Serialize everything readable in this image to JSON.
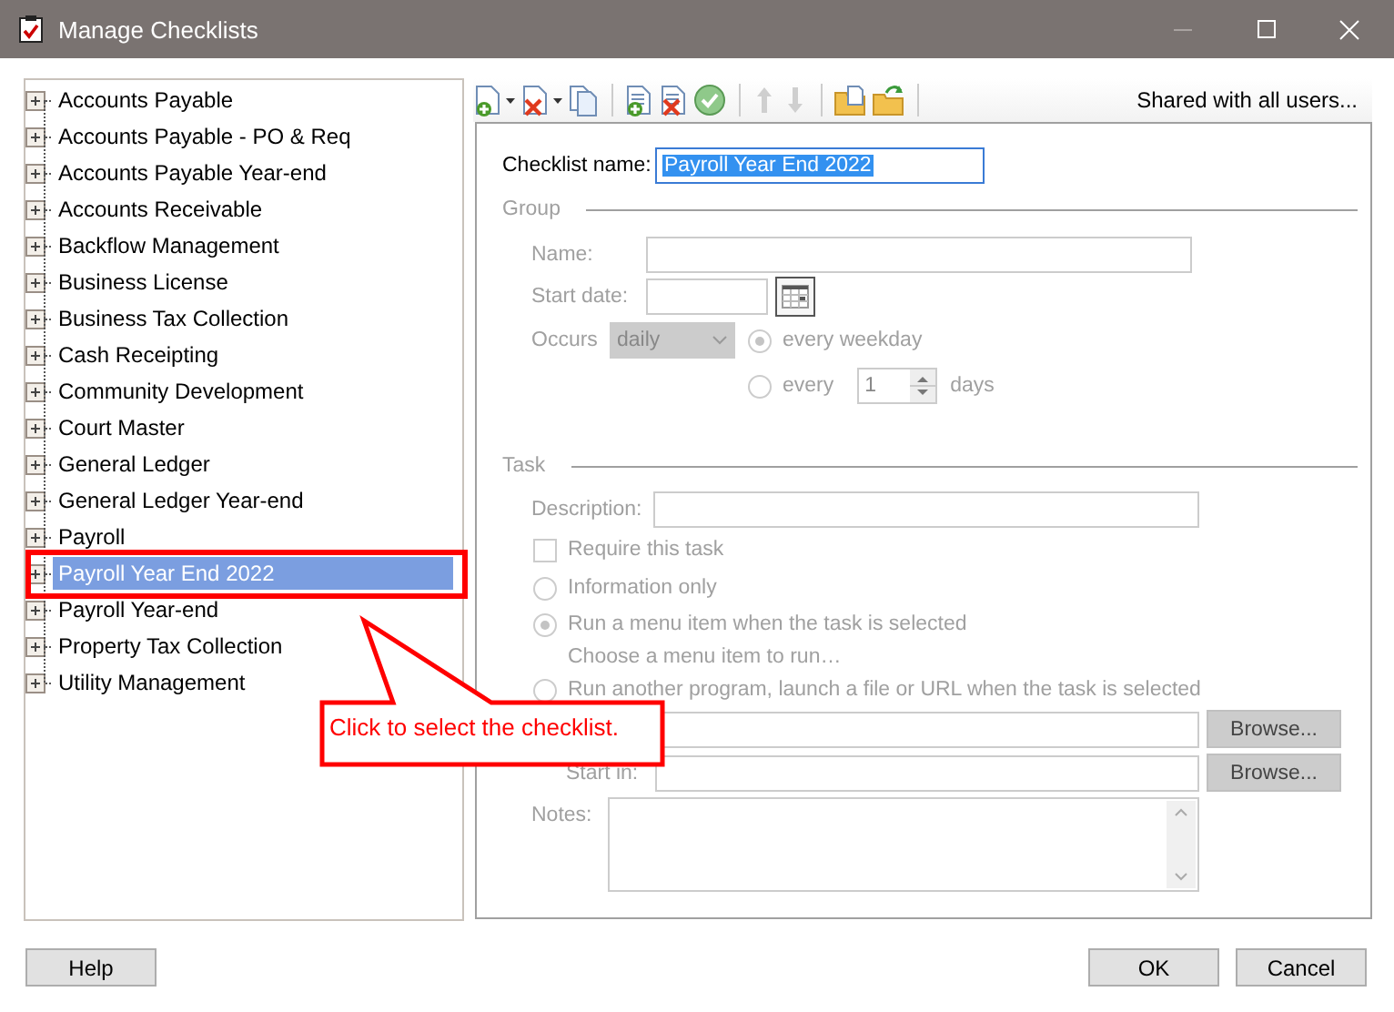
{
  "window": {
    "title": "Manage Checklists"
  },
  "checklists": [
    {
      "label": "Accounts Payable",
      "selected": false
    },
    {
      "label": "Accounts Payable - PO & Req",
      "selected": false
    },
    {
      "label": "Accounts Payable Year-end",
      "selected": false
    },
    {
      "label": "Accounts Receivable",
      "selected": false
    },
    {
      "label": "Backflow Management",
      "selected": false
    },
    {
      "label": "Business License",
      "selected": false
    },
    {
      "label": "Business Tax Collection",
      "selected": false
    },
    {
      "label": "Cash Receipting",
      "selected": false
    },
    {
      "label": "Community Development",
      "selected": false
    },
    {
      "label": "Court Master",
      "selected": false
    },
    {
      "label": "General Ledger",
      "selected": false
    },
    {
      "label": "General Ledger Year-end",
      "selected": false
    },
    {
      "label": "Payroll",
      "selected": false
    },
    {
      "label": "Payroll Year End 2022",
      "selected": true
    },
    {
      "label": "Payroll Year-end",
      "selected": false
    },
    {
      "label": "Property Tax Collection",
      "selected": false
    },
    {
      "label": "Utility Management",
      "selected": false
    }
  ],
  "toolbar": {
    "shared_link": "Shared with all users..."
  },
  "form": {
    "checklist_name_label": "Checklist name:",
    "checklist_name": "Payroll Year End 2022",
    "group": {
      "heading": "Group",
      "disabled": true,
      "name_label": "Name:",
      "start_date_label": "Start date:",
      "occurs_label": "Occurs",
      "occurs_value": "daily",
      "options": [
        {
          "label": "every weekday",
          "selected": true
        },
        {
          "label": "every",
          "selected": false
        }
      ],
      "every_value": "1",
      "days_label": "days"
    },
    "task": {
      "heading": "Task",
      "disabled": true,
      "description_label": "Description:",
      "require": {
        "label": "Require this task",
        "checked": false
      },
      "modes": [
        {
          "label": "Information only",
          "selected": false
        },
        {
          "label": "Run a menu item when the task is selected",
          "selected": true
        },
        {
          "label": "Run another program, launch a file or URL when the task is selected",
          "selected": false
        }
      ],
      "menu_hint": "Choose a menu item to run…",
      "browse_buttons": [
        "Browse...",
        "Browse..."
      ],
      "start_in_label": "Start in:",
      "notes_label": "Notes:"
    }
  },
  "callout": {
    "text": "Click to select the checklist."
  },
  "buttons": {
    "help": "Help",
    "ok": "OK",
    "cancel": "Cancel"
  }
}
